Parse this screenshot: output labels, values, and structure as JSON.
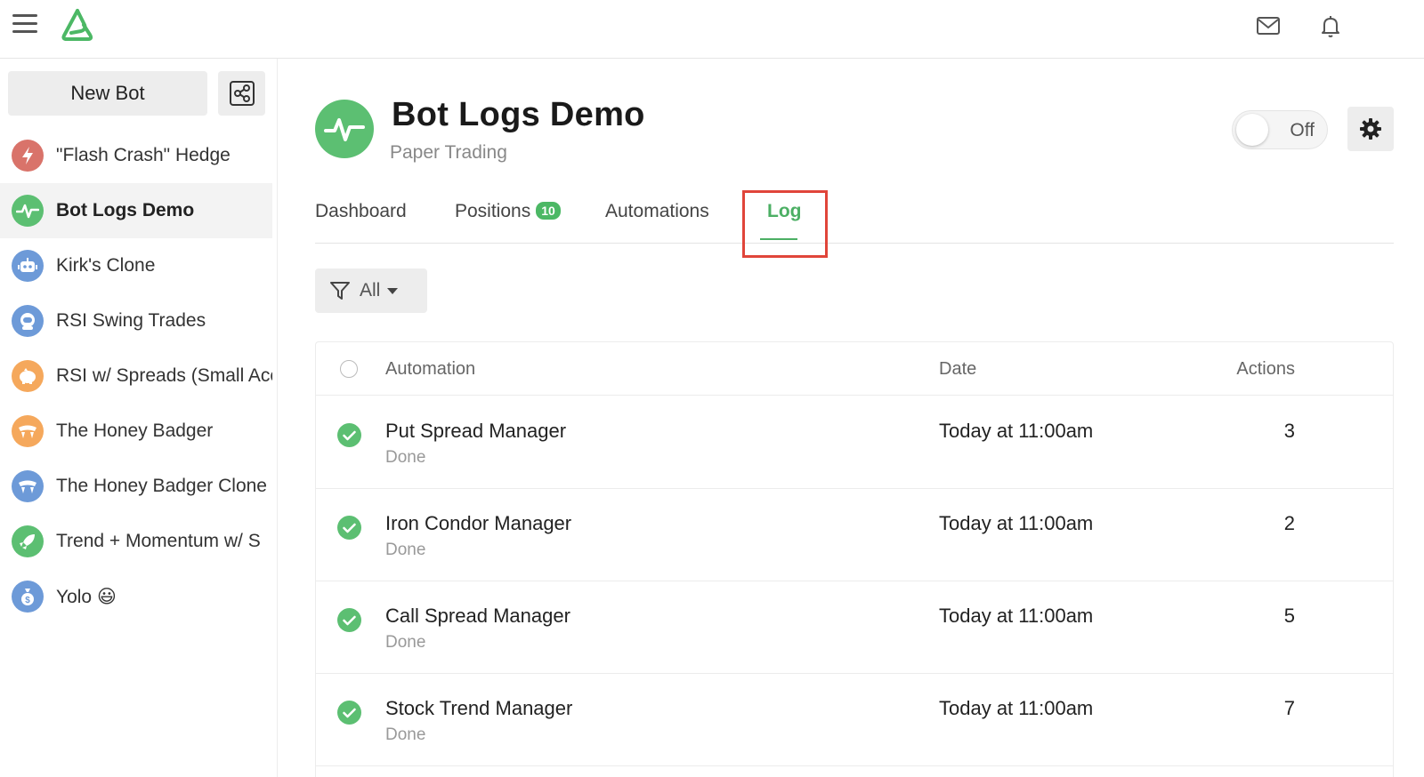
{
  "sidebar": {
    "new_bot_label": "New Bot",
    "bots": [
      {
        "label": "\"Flash Crash\" Hedge",
        "icon": "lightning-icon",
        "color": "#d9736a"
      },
      {
        "label": "Bot Logs Demo",
        "icon": "pulse-icon",
        "color": "#5cbf72",
        "active": true
      },
      {
        "label": "Kirk's Clone",
        "icon": "robot-icon",
        "color": "#6d9ad8"
      },
      {
        "label": "RSI Swing Trades",
        "icon": "astronaut-icon",
        "color": "#6d9ad8"
      },
      {
        "label": "RSI w/ Spreads (Small Acc",
        "icon": "piggy-bank-icon",
        "color": "#f5a85c"
      },
      {
        "label": "The Honey Badger",
        "icon": "badger-icon",
        "color": "#f5a85c"
      },
      {
        "label": "The Honey Badger Clone",
        "icon": "badger-icon",
        "color": "#6d9ad8"
      },
      {
        "label": "Trend + Momentum w/ S",
        "icon": "rocket-icon",
        "color": "#5cbf72"
      },
      {
        "label": "Yolo 😃",
        "icon": "money-bag-icon",
        "color": "#6d9ad8"
      }
    ]
  },
  "header": {
    "title": "Bot Logs Demo",
    "subtitle": "Paper Trading",
    "toggle_label": "Off"
  },
  "tabs": {
    "dashboard": "Dashboard",
    "positions": "Positions",
    "positions_count": "10",
    "automations": "Automations",
    "log": "Log"
  },
  "filter": {
    "label": "All"
  },
  "table": {
    "columns": {
      "automation": "Automation",
      "date": "Date",
      "actions": "Actions"
    },
    "rows": [
      {
        "name": "Put Spread Manager",
        "status": "Done",
        "date": "Today at 11:00am",
        "actions": "3"
      },
      {
        "name": "Iron Condor Manager",
        "status": "Done",
        "date": "Today at 11:00am",
        "actions": "2"
      },
      {
        "name": "Call Spread Manager",
        "status": "Done",
        "date": "Today at 11:00am",
        "actions": "5"
      },
      {
        "name": "Stock Trend Manager",
        "status": "Done",
        "date": "Today at 11:00am",
        "actions": "7"
      }
    ]
  },
  "colors": {
    "accent": "#5cbf72",
    "highlight": "#e0453a"
  }
}
